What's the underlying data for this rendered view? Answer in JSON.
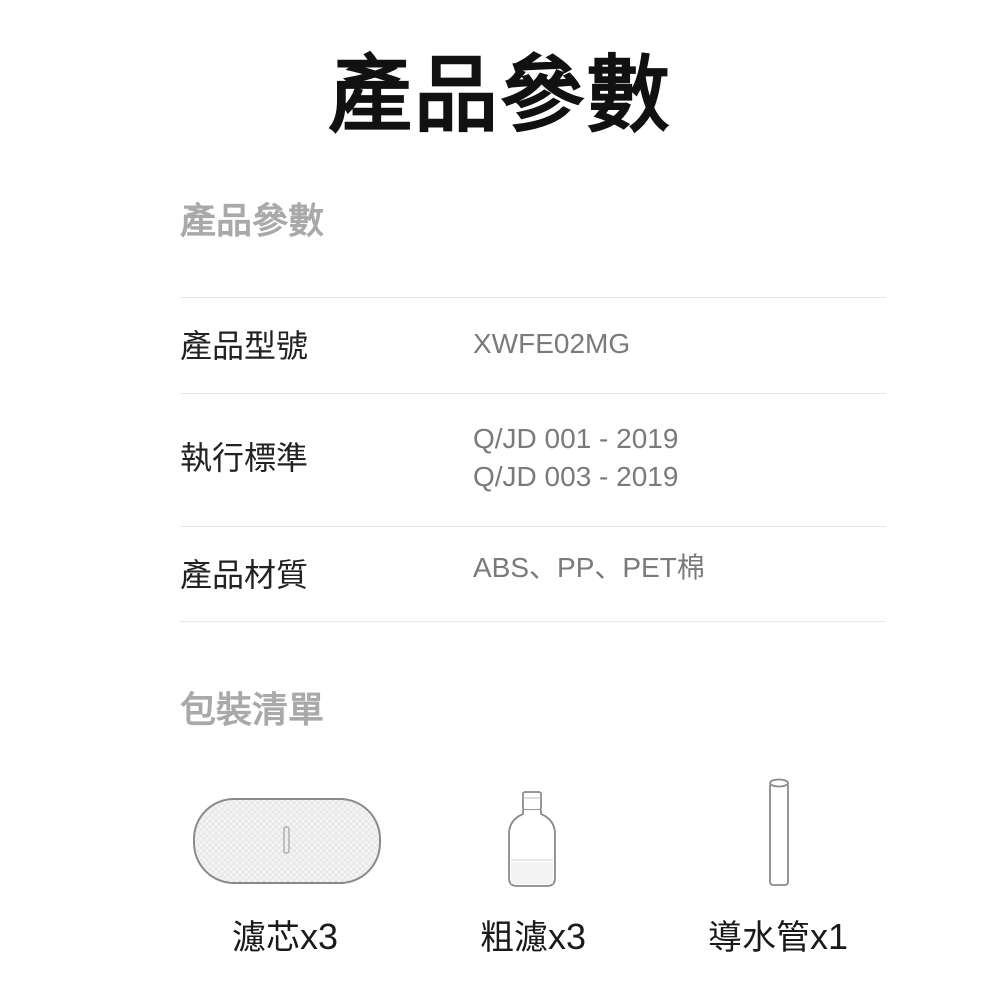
{
  "title": "產品參數",
  "specs_section": {
    "heading": "產品參數",
    "rows": [
      {
        "label": "產品型號",
        "values": [
          "XWFE02MG"
        ]
      },
      {
        "label": "執行標準",
        "values": [
          "Q/JD 001 - 2019",
          "Q/JD 003 - 2019"
        ]
      },
      {
        "label": "產品材質",
        "values": [
          "ABS、PP、PET棉"
        ]
      }
    ]
  },
  "package_section": {
    "heading": "包裝清單",
    "items": [
      {
        "name": "濾芯",
        "qty": "x3",
        "icon": "filter-cartridge-icon"
      },
      {
        "name": "粗濾",
        "qty": "x3",
        "icon": "coarse-filter-icon"
      },
      {
        "name": "導水管",
        "qty": "x1",
        "icon": "water-pipe-icon"
      }
    ]
  }
}
